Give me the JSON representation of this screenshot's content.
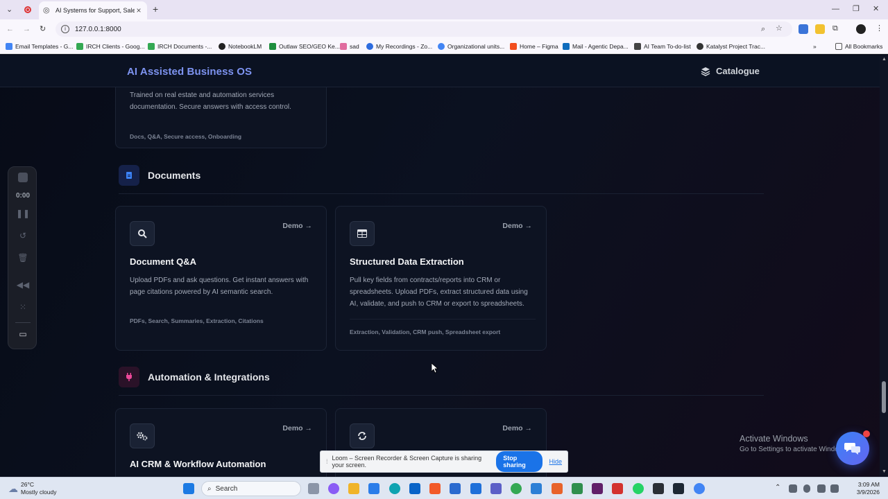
{
  "browser": {
    "tab_title": "AI Systems for Support, Sales, a",
    "url": "127.0.0.1:8000",
    "bookmarks": [
      "Email Templates - G...",
      "IRCH Clients - Goog...",
      "IRCH Documents -...",
      "NotebookLM",
      "Outlaw SEO/GEO Ke...",
      "sad",
      "My Recordings - Zo...",
      "Organizational units...",
      "Home – Figma",
      "Mail - Agentic Depa...",
      "AI Team To-do-list",
      "Katalyst Project Trac..."
    ],
    "all_bookmarks": "All Bookmarks"
  },
  "header": {
    "brand": "AI Assisted Business OS",
    "catalogue": "Catalogue"
  },
  "partial_card": {
    "desc": "Trained on real estate and automation services documentation. Secure answers with access control.",
    "tags": "Docs, Q&A, Secure access, Onboarding"
  },
  "sections": {
    "documents": {
      "title": "Documents",
      "cards": [
        {
          "icon": "search-icon",
          "demo": "Demo →",
          "title": "Document Q&A",
          "desc": "Upload PDFs and ask questions. Get instant answers with page citations powered by AI semantic search.",
          "tags": "PDFs, Search, Summaries, Extraction, Citations"
        },
        {
          "icon": "table-icon",
          "demo": "Demo →",
          "title": "Structured Data Extraction",
          "desc": "Pull key fields from contracts/reports into CRM or spreadsheets. Upload PDFs, extract structured data using AI, validate, and push to CRM or export to spreadsheets.",
          "tags": "Extraction, Validation, CRM push, Spreadsheet export"
        }
      ]
    },
    "automation": {
      "title": "Automation & Integrations",
      "cards": [
        {
          "icon": "cogs-icon",
          "demo": "Demo →",
          "title": "AI CRM & Workflow Automation"
        },
        {
          "icon": "sync-icon",
          "demo": "Demo →",
          "title": ""
        }
      ]
    }
  },
  "loom": {
    "timer": "0:00",
    "share_text": "Loom – Screen Recorder & Screen Capture is sharing your screen.",
    "stop_sharing": "Stop sharing",
    "hide": "Hide"
  },
  "activate_windows": {
    "title": "Activate Windows",
    "subtitle": "Go to Settings to activate Windows."
  },
  "taskbar": {
    "temperature": "26°C",
    "weather": "Mostly cloudy",
    "search": "Search",
    "time": "3:09 AM",
    "date": "3/9/2026"
  }
}
